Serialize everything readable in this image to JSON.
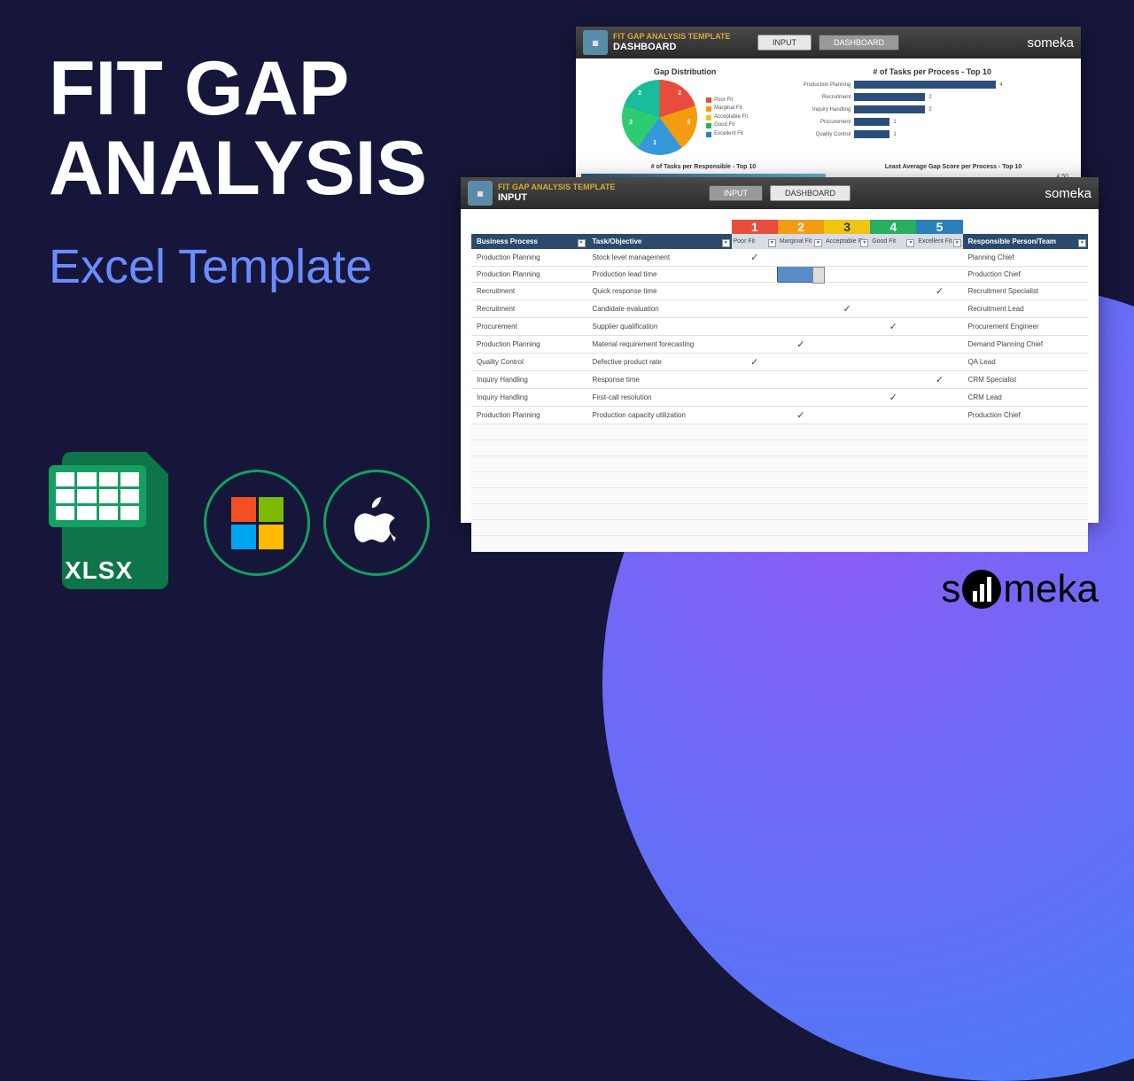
{
  "title_line1": "FIT GAP",
  "title_line2": "ANALYSIS",
  "subtitle": "Excel Template",
  "xlsx_label": "XLSX",
  "brand": "someka",
  "dashboard": {
    "template_title": "FIT GAP ANALYSIS TEMPLATE",
    "section": "DASHBOARD",
    "btn_input": "INPUT",
    "btn_dash": "DASHBOARD",
    "pie_title": "Gap Distribution",
    "bars_title": "# of Tasks per Process - Top 10",
    "bottom_left": "# of Tasks per Responsible - Top 10",
    "bottom_right": "Least Average Gap Score per Process - Top 10",
    "bottom_right_val": "4.50",
    "legend": [
      "Poor Fit",
      "Marginal Fit",
      "Acceptable Fit",
      "Good Fit",
      "Excellent Fit"
    ],
    "legend_colors": [
      "#e74c3c",
      "#f39c12",
      "#f1c40f",
      "#27ae60",
      "#2980b9"
    ],
    "bars": [
      {
        "label": "Production Planning",
        "val": 4
      },
      {
        "label": "Recruitment",
        "val": 2
      },
      {
        "label": "Inquiry Handling",
        "val": 2
      },
      {
        "label": "Procurement",
        "val": 1
      },
      {
        "label": "Quality Control",
        "val": 1
      }
    ]
  },
  "input": {
    "template_title": "FIT GAP ANALYSIS TEMPLATE",
    "section": "INPUT",
    "btn_input": "INPUT",
    "btn_dash": "DASHBOARD",
    "headers": {
      "bp": "Business Process",
      "task": "Task/Objective",
      "resp": "Responsible Person/Team"
    },
    "scale": [
      {
        "num": "1",
        "label": "Poor Fit"
      },
      {
        "num": "2",
        "label": "Marginal Fit"
      },
      {
        "num": "3",
        "label": "Acceptable Fit"
      },
      {
        "num": "4",
        "label": "Good Fit"
      },
      {
        "num": "5",
        "label": "Excellent Fit"
      }
    ],
    "rows": [
      {
        "bp": "Production Planning",
        "task": "Stock level management",
        "score": 1,
        "resp": "Planning Chief"
      },
      {
        "bp": "Production Planning",
        "task": "Production lead time",
        "score": 2,
        "resp": "Production Chief",
        "selected": true
      },
      {
        "bp": "Recruitment",
        "task": "Quick response time",
        "score": 5,
        "resp": "Recruitment Specialist"
      },
      {
        "bp": "Recruitment",
        "task": "Candidate evaluation",
        "score": 3,
        "resp": "Recruitment Lead"
      },
      {
        "bp": "Procurement",
        "task": "Supplier qualification",
        "score": 4,
        "resp": "Procurement Engineer"
      },
      {
        "bp": "Production Planning",
        "task": "Material requirement forecasting",
        "score": 2,
        "resp": "Demand Planning Chief"
      },
      {
        "bp": "Quality Control",
        "task": "Defective product rate",
        "score": 1,
        "resp": "QA Lead"
      },
      {
        "bp": "Inquiry Handling",
        "task": "Response time",
        "score": 5,
        "resp": "CRM Specialist"
      },
      {
        "bp": "Inquiry Handling",
        "task": "First-call resolution",
        "score": 4,
        "resp": "CRM Lead"
      },
      {
        "bp": "Production Planning",
        "task": "Production capacity utilization",
        "score": 2,
        "resp": "Production Chief"
      }
    ]
  },
  "chart_data": {
    "type": "pie",
    "title": "Gap Distribution",
    "categories": [
      "Poor Fit",
      "Marginal Fit",
      "Acceptable Fit",
      "Good Fit",
      "Excellent Fit"
    ],
    "values": [
      2,
      3,
      1,
      2,
      2
    ]
  }
}
